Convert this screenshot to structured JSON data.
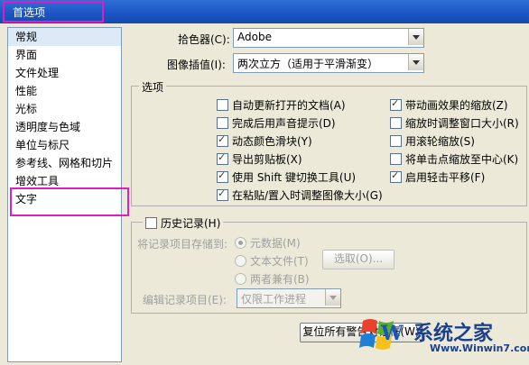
{
  "window": {
    "title": "首选项"
  },
  "sidebar": {
    "items": [
      {
        "label": "常规"
      },
      {
        "label": "界面"
      },
      {
        "label": "文件处理"
      },
      {
        "label": "性能"
      },
      {
        "label": "光标"
      },
      {
        "label": "透明度与色域"
      },
      {
        "label": "单位与标尺"
      },
      {
        "label": "参考线、网格和切片"
      },
      {
        "label": "增效工具"
      },
      {
        "label": "文字"
      }
    ]
  },
  "general": {
    "picker_label": "拾色器(C):",
    "picker_value": "Adobe",
    "interp_label": "图像插值(I):",
    "interp_value": "两次立方（适用于平滑渐变）"
  },
  "options": {
    "title": "选项",
    "left": [
      {
        "label": "自动更新打开的文档(A)",
        "checked": false
      },
      {
        "label": "完成后用声音提示(D)",
        "checked": false
      },
      {
        "label": "动态颜色滑块(Y)",
        "checked": true
      },
      {
        "label": "导出剪贴板(X)",
        "checked": true
      },
      {
        "label": "使用 Shift 键切换工具(U)",
        "checked": true
      },
      {
        "label": "在粘贴/置入时调整图像大小(G)",
        "checked": true
      }
    ],
    "right": [
      {
        "label": "带动画效果的缩放(Z)",
        "checked": true
      },
      {
        "label": "缩放时调整窗口大小(R)",
        "checked": false
      },
      {
        "label": "用滚轮缩放(S)",
        "checked": false
      },
      {
        "label": "将单击点缩放至中心(K)",
        "checked": false
      },
      {
        "label": "启用轻击平移(F)",
        "checked": true
      }
    ]
  },
  "history": {
    "title": "历史记录(H)",
    "save_to_label": "将记录项目存储到:",
    "radio_meta": "元数据(M)",
    "radio_text": "文本文件(T)",
    "choose_button": "选取(O)...",
    "radio_both": "两者兼有(B)",
    "edit_label": "编辑记录项目(E):",
    "edit_value": "仅限工作进程"
  },
  "footer": {
    "reset_button": "复位所有警告对话框(W)"
  },
  "watermark": {
    "brand": "系统之家",
    "url": "Www.Winwin7.com",
    "logo_text": "W"
  }
}
